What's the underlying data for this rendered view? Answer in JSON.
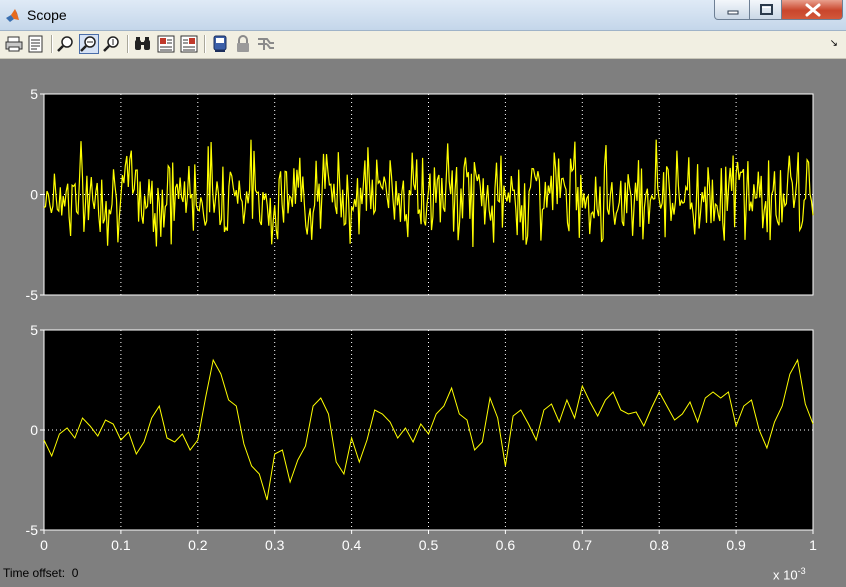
{
  "window": {
    "title": "Scope"
  },
  "toolbar": {
    "buttons": [
      {
        "name": "print-icon"
      },
      {
        "name": "parameters-icon"
      },
      {
        "name": "zoom-icon"
      },
      {
        "name": "zoom-x-axis-icon",
        "active": true
      },
      {
        "name": "zoom-y-axis-icon"
      },
      {
        "name": "autoscale-icon"
      },
      {
        "name": "save-axes-settings-icon"
      },
      {
        "name": "restore-axes-settings-icon"
      },
      {
        "name": "floating-scope-icon"
      },
      {
        "name": "lock-axes-icon"
      },
      {
        "name": "signal-selection-icon"
      }
    ]
  },
  "status": {
    "time_offset_label": "Time offset:",
    "time_offset_value": "0",
    "exponent": "x 10"
  },
  "colors": {
    "trace": "#ffff00",
    "plot_bg": "#000000",
    "figure_bg": "#7f7f7f",
    "grid": "#ffffff"
  },
  "chart_data": [
    {
      "type": "line",
      "name": "upper-axes",
      "ylim": [
        -5,
        5
      ],
      "xlim": [
        0,
        1
      ],
      "yticks": [
        "5",
        "0",
        "-5"
      ],
      "xtick_labels": [],
      "grid": true,
      "noise_amplitude": 1.1,
      "x": [
        0,
        0.05,
        0.1,
        0.15,
        0.2,
        0.25,
        0.3,
        0.35,
        0.4,
        0.45,
        0.5,
        0.55,
        0.6,
        0.65,
        0.7,
        0.75,
        0.8,
        0.85,
        0.9,
        0.95,
        1.0
      ],
      "y": [
        0.2,
        -0.3,
        0.5,
        -0.6,
        0.3,
        0.9,
        -0.8,
        0.4,
        -0.2,
        0.7,
        -0.5,
        0.3,
        -0.9,
        0.6,
        0.2,
        -0.4,
        0.8,
        -0.3,
        0.5,
        -0.7,
        -0.2
      ]
    },
    {
      "type": "line",
      "name": "lower-axes",
      "ylim": [
        -5,
        5
      ],
      "xlim": [
        0,
        1
      ],
      "yticks": [
        "5",
        "0",
        "-5"
      ],
      "xtick_labels": [
        "0",
        "0.1",
        "0.2",
        "0.3",
        "0.4",
        "0.5",
        "0.6",
        "0.7",
        "0.8",
        "0.9",
        "1"
      ],
      "x_exponent": "-3",
      "grid": true,
      "x": [
        0,
        0.01,
        0.02,
        0.03,
        0.04,
        0.05,
        0.06,
        0.07,
        0.08,
        0.09,
        0.1,
        0.11,
        0.12,
        0.13,
        0.14,
        0.15,
        0.16,
        0.17,
        0.18,
        0.19,
        0.2,
        0.21,
        0.22,
        0.23,
        0.24,
        0.25,
        0.26,
        0.27,
        0.28,
        0.29,
        0.3,
        0.31,
        0.32,
        0.33,
        0.34,
        0.35,
        0.36,
        0.37,
        0.38,
        0.39,
        0.4,
        0.41,
        0.42,
        0.43,
        0.44,
        0.45,
        0.46,
        0.47,
        0.48,
        0.49,
        0.5,
        0.51,
        0.52,
        0.53,
        0.54,
        0.55,
        0.56,
        0.57,
        0.58,
        0.59,
        0.6,
        0.61,
        0.62,
        0.63,
        0.64,
        0.65,
        0.66,
        0.67,
        0.68,
        0.69,
        0.7,
        0.71,
        0.72,
        0.73,
        0.74,
        0.75,
        0.76,
        0.77,
        0.78,
        0.79,
        0.8,
        0.81,
        0.82,
        0.83,
        0.84,
        0.85,
        0.86,
        0.87,
        0.88,
        0.89,
        0.9,
        0.91,
        0.92,
        0.93,
        0.94,
        0.95,
        0.96,
        0.97,
        0.98,
        0.99,
        1.0
      ],
      "y": [
        -0.5,
        -1.3,
        -0.2,
        0.1,
        -0.4,
        0.6,
        0.2,
        -0.3,
        0.5,
        0.3,
        -0.5,
        -0.1,
        -1.2,
        -0.6,
        0.6,
        1.2,
        -0.4,
        -0.6,
        -0.2,
        -1.0,
        -0.5,
        1.6,
        3.5,
        2.8,
        1.5,
        1.2,
        -0.7,
        -1.8,
        -2.2,
        -3.5,
        -1.2,
        -1.0,
        -2.6,
        -1.5,
        -0.8,
        1.2,
        1.6,
        0.8,
        -1.6,
        -2.2,
        -0.4,
        -1.6,
        -0.5,
        1.0,
        0.8,
        0.4,
        -0.4,
        0.1,
        -0.6,
        0.3,
        -0.2,
        0.8,
        1.2,
        2.1,
        0.8,
        0.5,
        -1.0,
        -0.6,
        1.6,
        0.6,
        -1.8,
        0.7,
        1.0,
        0.3,
        -0.5,
        1.0,
        1.3,
        0.4,
        1.5,
        0.6,
        2.2,
        1.4,
        0.7,
        1.5,
        1.9,
        1.0,
        0.8,
        0.9,
        0.2,
        1.1,
        1.9,
        1.2,
        0.5,
        0.8,
        1.4,
        0.4,
        1.6,
        1.9,
        1.6,
        1.9,
        0.2,
        1.2,
        1.5,
        0.0,
        -0.9,
        0.4,
        1.2,
        2.8,
        3.5,
        1.3,
        0.3
      ]
    }
  ]
}
